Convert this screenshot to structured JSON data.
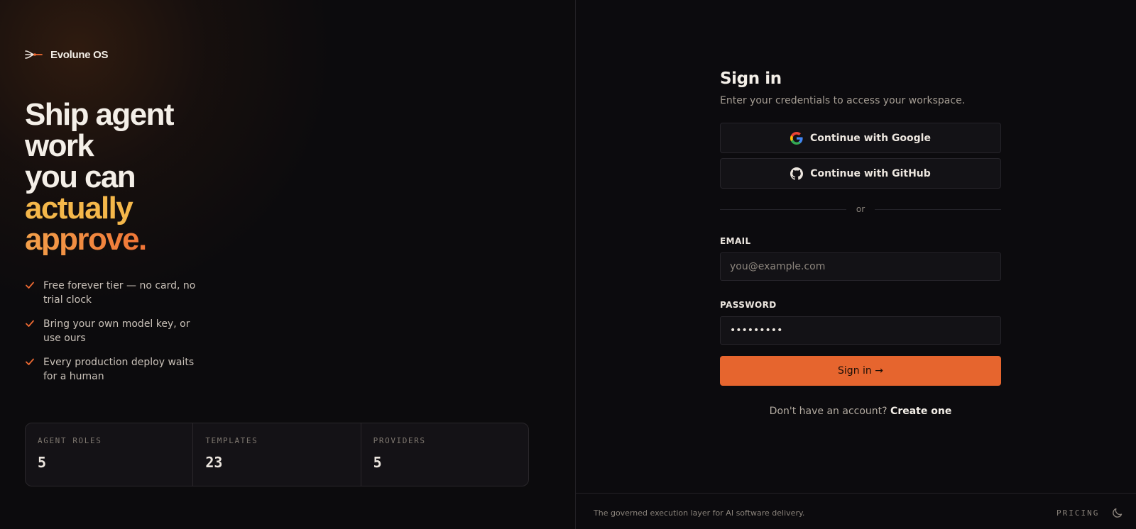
{
  "brand": {
    "name": "Evolune OS",
    "icon": "evolune-logo-icon"
  },
  "hero": {
    "line1": "Ship agent",
    "line2": "work",
    "line3": "you can",
    "line4": "actually",
    "line5": "approve.",
    "accent_color_1": "#f4b74a",
    "accent_color_2": "#ee6a32"
  },
  "checklist": [
    {
      "text": "Free forever tier — no card, no trial clock",
      "icon": "check-icon"
    },
    {
      "text": "Bring your own model key, or use ours",
      "icon": "check-icon"
    },
    {
      "text": "Every production deploy waits for a human",
      "icon": "check-icon"
    }
  ],
  "stats": [
    {
      "label": "AGENT ROLES",
      "value": "5"
    },
    {
      "label": "TEMPLATES",
      "value": "23"
    },
    {
      "label": "PROVIDERS",
      "value": "5"
    }
  ],
  "signin": {
    "title": "Sign in",
    "subtitle": "Enter your credentials to access your workspace.",
    "google_label": "Continue with Google",
    "github_label": "Continue with GitHub",
    "divider_text": "or",
    "email_label": "EMAIL",
    "email_placeholder": "you@example.com",
    "email_value": "",
    "password_label": "PASSWORD",
    "password_value": "•••••••••",
    "submit_label": "Sign in →",
    "submit_color": "#e6652e",
    "no_account_text": "Don't have an account?",
    "create_link": "Create one"
  },
  "footer": {
    "tagline": "The governed execution layer for AI software delivery.",
    "pricing_label": "PRICING",
    "theme_icon": "moon-icon"
  }
}
